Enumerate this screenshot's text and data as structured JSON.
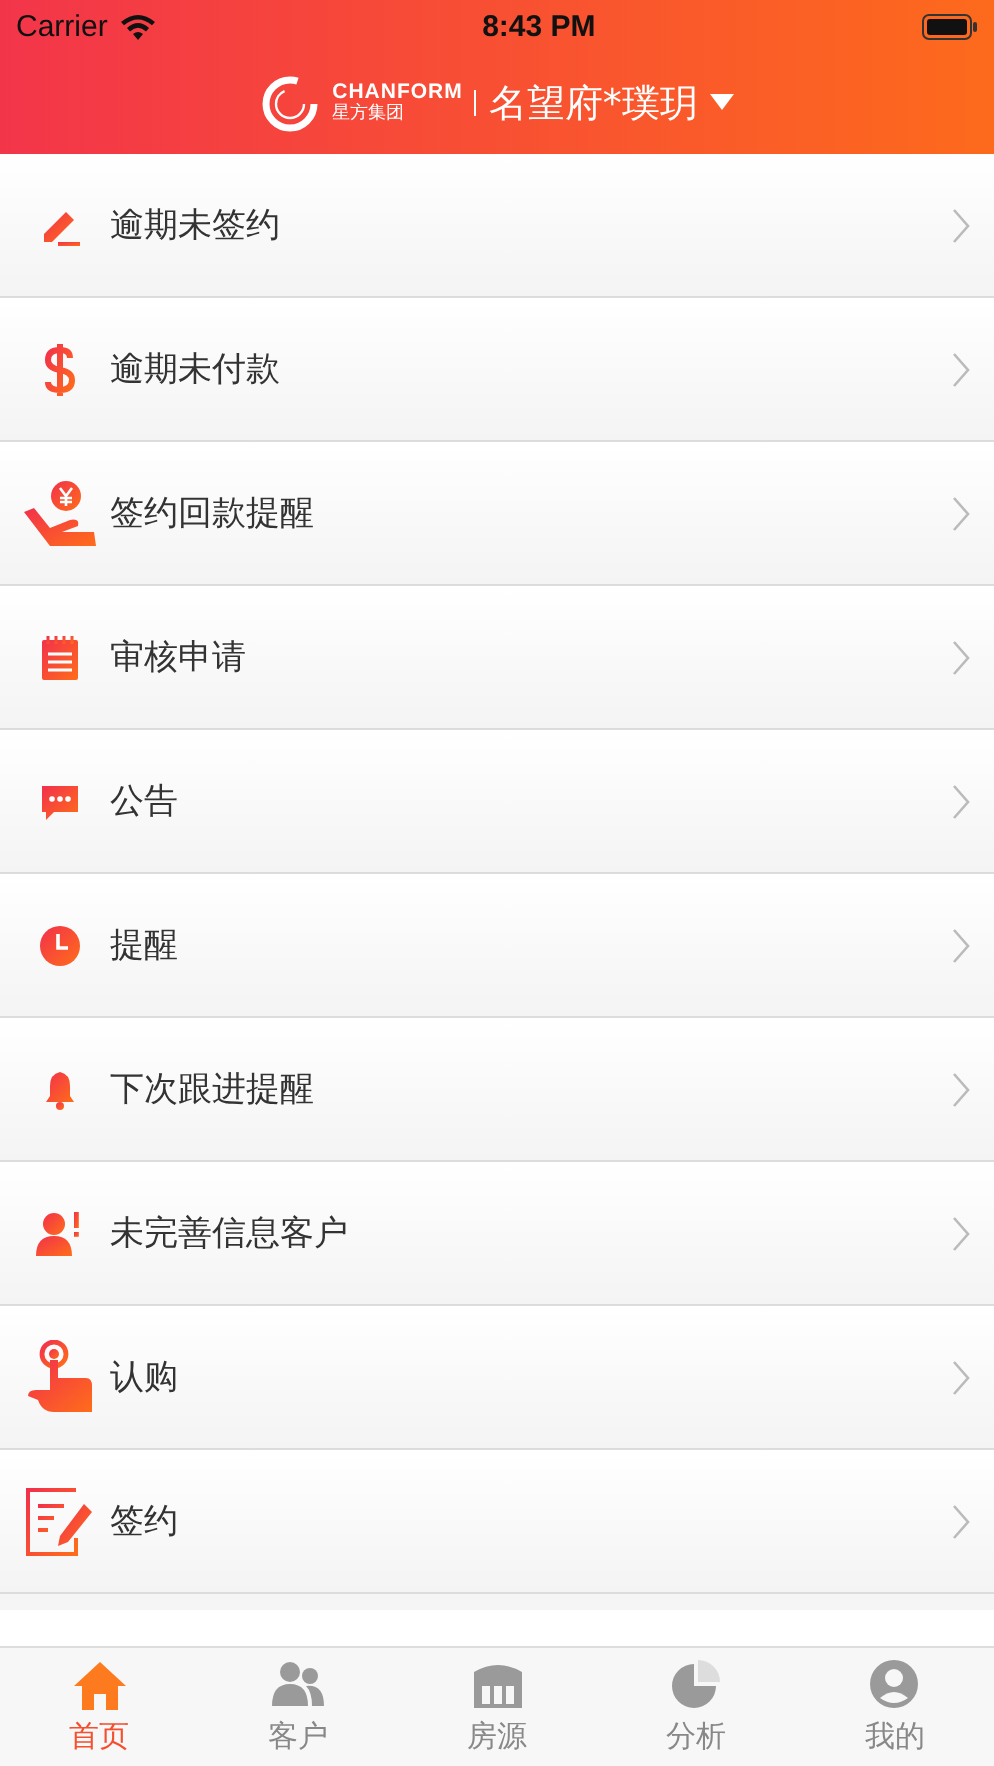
{
  "status_bar": {
    "carrier": "Carrier",
    "time": "8:43 PM"
  },
  "header": {
    "logo_text": "CHANFORM",
    "logo_subtext": "星方集团",
    "project": "名望府*璞玥"
  },
  "menu": [
    {
      "label": "逾期未签约"
    },
    {
      "label": "逾期未付款"
    },
    {
      "label": "签约回款提醒"
    },
    {
      "label": "审核申请"
    },
    {
      "label": "公告"
    },
    {
      "label": "提醒"
    },
    {
      "label": "下次跟进提醒"
    },
    {
      "label": "未完善信息客户"
    },
    {
      "label": "认购"
    },
    {
      "label": "签约"
    }
  ],
  "tab_bar": [
    {
      "label": "首页",
      "selected": true
    },
    {
      "label": "客户",
      "selected": false
    },
    {
      "label": "房源",
      "selected": false
    },
    {
      "label": "分析",
      "selected": false
    },
    {
      "label": "我的",
      "selected": false
    }
  ]
}
